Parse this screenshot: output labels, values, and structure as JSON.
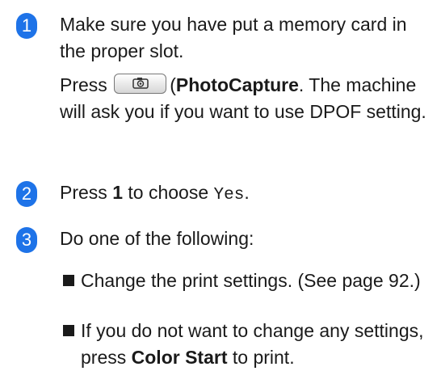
{
  "steps": [
    {
      "number": "1",
      "para1": "Make sure you have put a memory card in the proper slot.",
      "press_prefix": "Press",
      "button_icon": "camera-icon",
      "button_label": "PhotoCapture",
      "para2_suffix": ". The machine will ask you if you want to use DPOF setting."
    },
    {
      "number": "2",
      "press": "Press",
      "key": "1",
      "middle": "to choose",
      "option": "Yes",
      "end": "."
    },
    {
      "number": "3",
      "text": "Do one of the following:",
      "bullets": [
        {
          "text": "Change the print settings. (See page 92.)"
        },
        {
          "prefix": "If you do not want to change any settings, press",
          "key": "Color Start",
          "suffix": "to print."
        }
      ]
    }
  ],
  "colors": {
    "step_badge": "#1e73e8",
    "text": "#1a1a1a"
  }
}
